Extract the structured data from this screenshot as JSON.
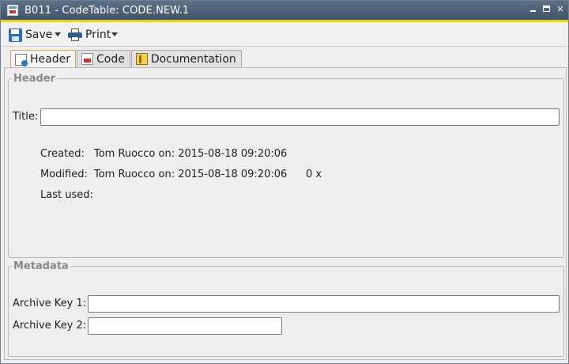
{
  "window": {
    "title": "B011 - CodeTable: CODE.NEW.1"
  },
  "toolbar": {
    "save_label": "Save",
    "print_label": "Print"
  },
  "tabs": [
    {
      "label": "Header",
      "icon": "header-tab-icon",
      "active": true
    },
    {
      "label": "Code",
      "icon": "code-tab-icon",
      "active": false
    },
    {
      "label": "Documentation",
      "icon": "documentation-tab-icon",
      "active": false
    }
  ],
  "header_group": {
    "legend": "Header",
    "title_label": "Title:",
    "title_value": "",
    "created_label": "Created:",
    "created_value": "Tom Ruocco on: 2015-08-18 09:20:06",
    "modified_label": "Modified:",
    "modified_value": "Tom Ruocco on: 2015-08-18 09:20:06",
    "modified_count": "0 x",
    "last_used_label": "Last used:",
    "last_used_value": ""
  },
  "metadata_group": {
    "legend": "Metadata",
    "archive_key_1_label": "Archive Key 1:",
    "archive_key_1_value": "",
    "archive_key_2_label": "Archive Key 2:",
    "archive_key_2_value": ""
  },
  "colors": {
    "titlebar": "#4d6278",
    "accent": "#f2d400",
    "active_tab_border": "#cfa850",
    "group_legend": "#8a8a8a"
  }
}
